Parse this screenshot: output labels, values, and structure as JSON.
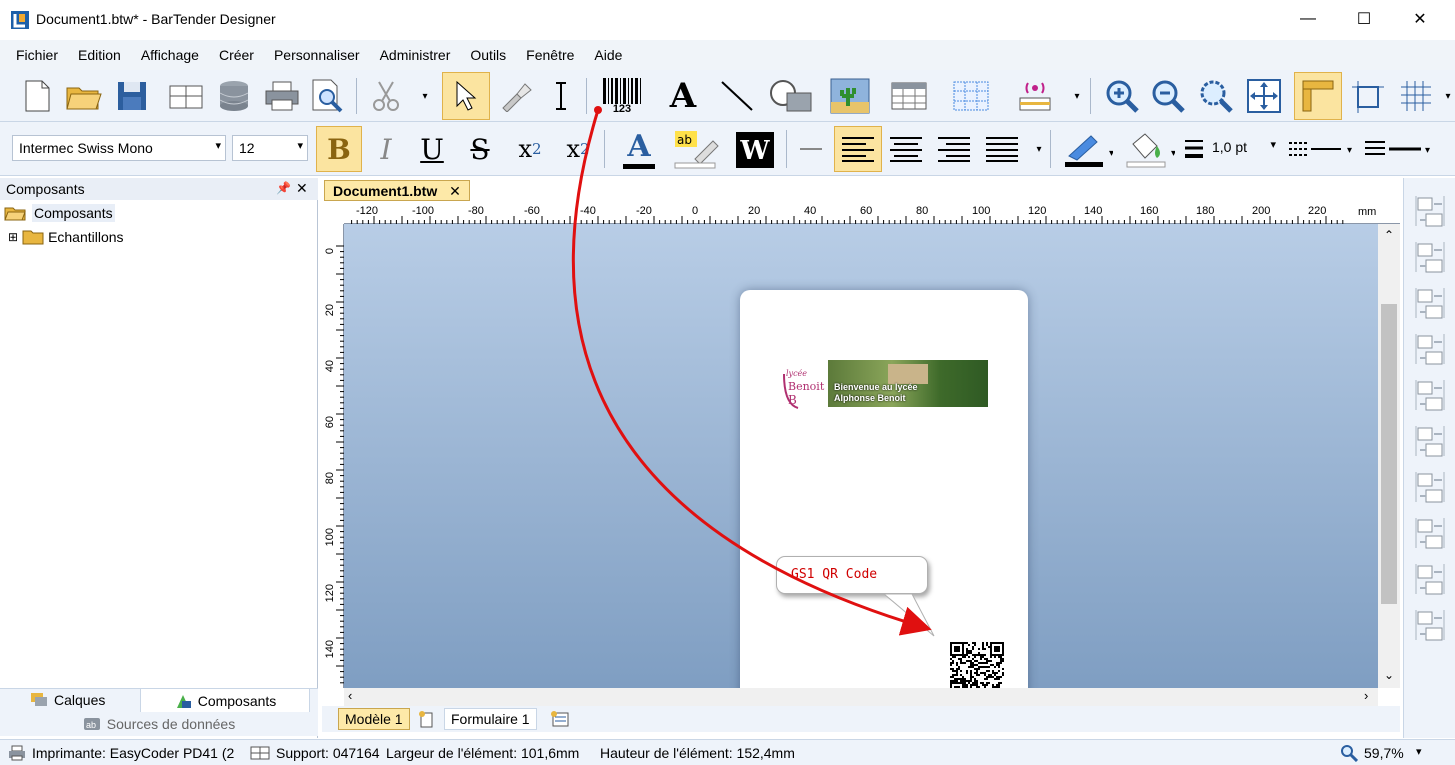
{
  "window": {
    "title": "Document1.btw* - BarTender Designer",
    "minimize_glyph": "—",
    "maximize_glyph": "☐",
    "close_glyph": "✕"
  },
  "menu": [
    "Fichier",
    "Edition",
    "Affichage",
    "Créer",
    "Personnaliser",
    "Administrer",
    "Outils",
    "Fenêtre",
    "Aide"
  ],
  "toolbar2": {
    "font_name": "Intermec Swiss Mono",
    "font_size": "12",
    "line_width": "1,0 pt"
  },
  "panel": {
    "title": "Composants",
    "pin_glyph": "📌",
    "close_glyph": "✕",
    "tree": [
      {
        "label": "Composants",
        "expander": ""
      },
      {
        "label": "Echantillons",
        "expander": "⊞"
      }
    ],
    "tab_layers": "Calques",
    "tab_components": "Composants",
    "tab_datasources": "Sources de données"
  },
  "document": {
    "tab_label": "Document1.btw",
    "tab_close": "✕",
    "ruler_unit": "mm",
    "h_ticks": [
      "-120",
      "-100",
      "-80",
      "-60",
      "-40",
      "-20",
      "0",
      "20",
      "40",
      "60",
      "80",
      "100",
      "120",
      "140",
      "160",
      "180",
      "200",
      "220"
    ],
    "v_ticks": [
      "0",
      "20",
      "40",
      "60",
      "80",
      "100",
      "120",
      "140"
    ],
    "banner_text": "Bienvenue au lycée Alphonse Benoit",
    "logo_text": "lycée Benoit",
    "callout": "GS1 QR Code",
    "barcode_digits": "123",
    "page_tabs": [
      "Modèle 1",
      "Formulaire 1"
    ]
  },
  "status": {
    "printer": "Imprimante: EasyCoder PD41 (2",
    "support": "Support: 047164",
    "width": "Largeur de l'élément: 101,6mm",
    "height": "Hauteur de l'élément: 152,4mm",
    "zoom": "59,7%"
  },
  "colors": {
    "accent": "#fbe4a0",
    "toolbar": "#eef3fa",
    "arrow": "#e01010"
  }
}
